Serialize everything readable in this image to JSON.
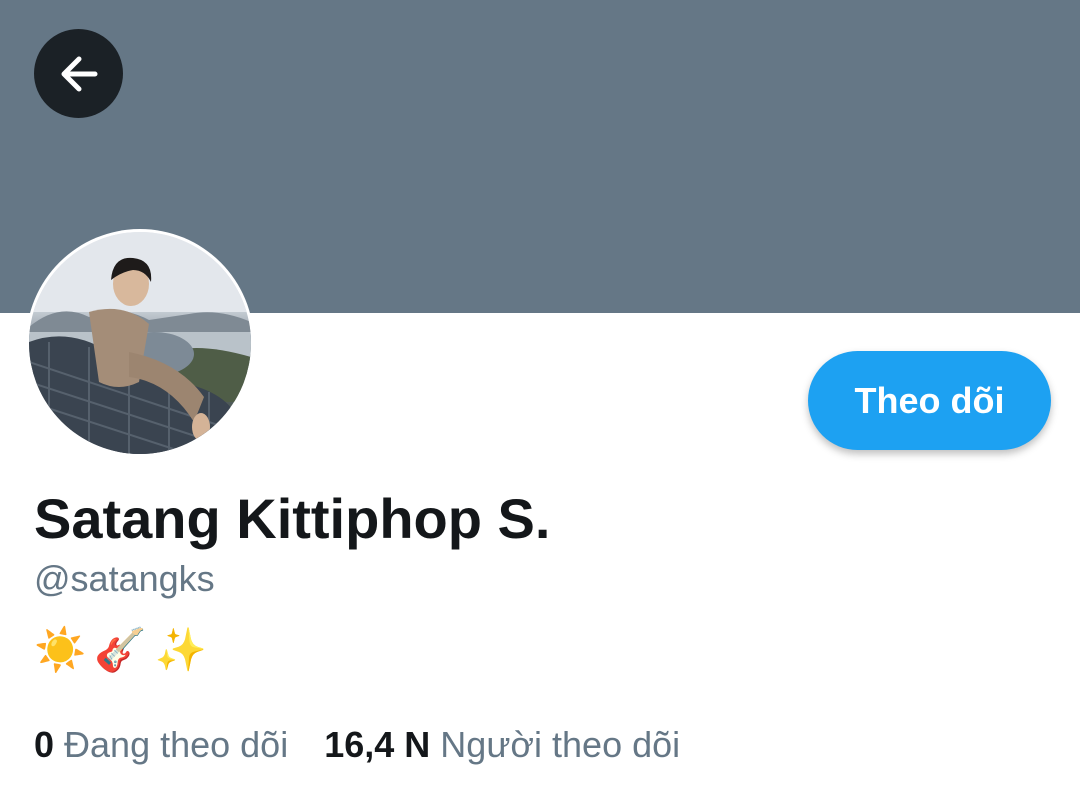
{
  "profile": {
    "display_name": "Satang Kittiphop S.",
    "handle": "@satangks",
    "bio_emojis": [
      "☀️",
      "🎸",
      "✨"
    ],
    "follow_label": "Theo dõi",
    "following_count": "0",
    "following_label": "Đang theo dõi",
    "followers_count": "16,4 N",
    "followers_label": "Người theo dõi"
  },
  "icons": {
    "back": "arrow-left-icon",
    "bio": [
      "sun-icon",
      "guitar-icon",
      "sparkles-icon"
    ]
  },
  "colors": {
    "banner": "#657786",
    "accent": "#1da1f2",
    "back_button": "#1b2126",
    "primary_text": "#14171a",
    "secondary_text": "#657786"
  }
}
